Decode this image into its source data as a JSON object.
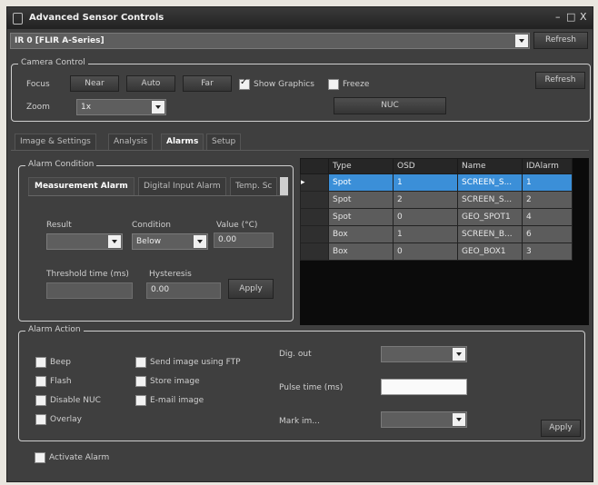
{
  "window": {
    "title": "Advanced Sensor Controls",
    "minimize": "–",
    "maximize": "□",
    "close": "X"
  },
  "device": {
    "selected": "IR 0 [FLIR A-Series]",
    "refresh_label": "Refresh"
  },
  "camera_control": {
    "title": "Camera Control",
    "focus_label": "Focus",
    "near_label": "Near",
    "auto_label": "Auto",
    "far_label": "Far",
    "show_graphics_label": "Show Graphics",
    "show_graphics_checked": true,
    "freeze_label": "Freeze",
    "freeze_checked": false,
    "refresh_label": "Refresh",
    "zoom_label": "Zoom",
    "zoom_value": "1x",
    "nuc_label": "NUC"
  },
  "tabs": [
    {
      "label": "Image & Settings",
      "active": false
    },
    {
      "label": "Analysis",
      "active": false
    },
    {
      "label": "Alarms",
      "active": true
    },
    {
      "label": "Setup",
      "active": false
    }
  ],
  "alarm_condition": {
    "title": "Alarm Condition",
    "subtabs": [
      {
        "label": "Measurement Alarm",
        "active": true
      },
      {
        "label": "Digital Input Alarm",
        "active": false
      },
      {
        "label": "Temp. Sc",
        "active": false
      }
    ],
    "result_label": "Result",
    "result_value": "",
    "condition_label": "Condition",
    "condition_value": "Below",
    "value_label": "Value (°C)",
    "value_value": "0.00",
    "threshold_label": "Threshold time (ms)",
    "threshold_value": "",
    "hysteresis_label": "Hysteresis",
    "hysteresis_value": "0.00",
    "apply_label": "Apply"
  },
  "alarm_table": {
    "columns": [
      "Type",
      "OSD",
      "Name",
      "IDAlarm"
    ],
    "rows": [
      {
        "marker": "▸",
        "type": "Spot",
        "osd": "1",
        "name": "SCREEN_S...",
        "id": "1",
        "selected": true
      },
      {
        "marker": "",
        "type": "Spot",
        "osd": "2",
        "name": "SCREEN_S...",
        "id": "2",
        "selected": false
      },
      {
        "marker": "",
        "type": "Spot",
        "osd": "0",
        "name": "GEO_SPOT1",
        "id": "4",
        "selected": false
      },
      {
        "marker": "",
        "type": "Box",
        "osd": "1",
        "name": "SCREEN_B...",
        "id": "6",
        "selected": false
      },
      {
        "marker": "",
        "type": "Box",
        "osd": "0",
        "name": "GEO_BOX1",
        "id": "3",
        "selected": false
      }
    ]
  },
  "alarm_action": {
    "title": "Alarm Action",
    "beep_label": "Beep",
    "flash_label": "Flash",
    "disable_nuc_label": "Disable NUC",
    "overlay_label": "Overlay",
    "ftp_label": "Send image using FTP",
    "store_label": "Store image",
    "email_label": "E-mail image",
    "dig_out_label": "Dig. out",
    "dig_out_value": "",
    "pulse_label": "Pulse time (ms)",
    "pulse_value": "",
    "mark_label": "Mark im...",
    "mark_value": "",
    "apply_label": "Apply"
  },
  "activate_alarm_label": "Activate Alarm",
  "colors": {
    "window_bg": "#3f3f3f",
    "selection": "#3b8fd8",
    "page_bg": "#e9e6df"
  }
}
